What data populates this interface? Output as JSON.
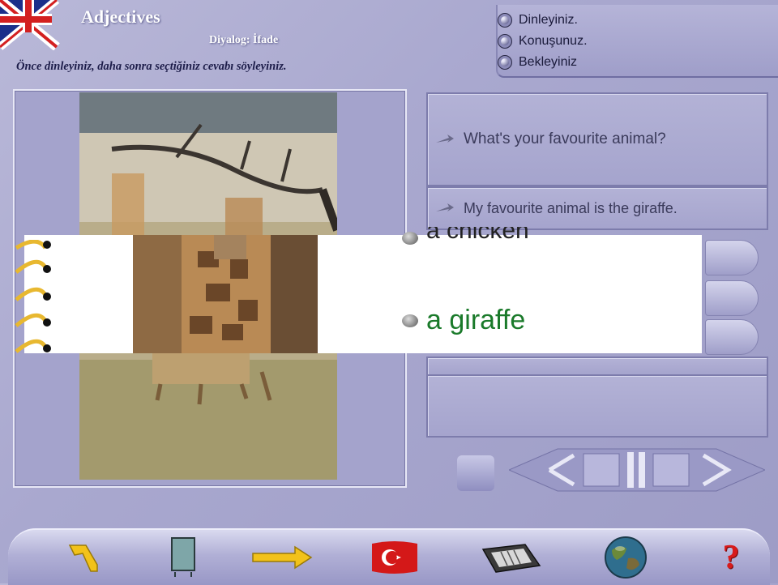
{
  "header": {
    "title": "Adjectives",
    "subtitle": "Diyalog: İfade",
    "instruction": "Önce dinleyiniz, daha sonra seçtiğiniz cevabı söyleyiniz."
  },
  "status": {
    "items": [
      {
        "label": "Dinleyiniz."
      },
      {
        "label": "Konuşunuz."
      },
      {
        "label": "Bekleyiniz"
      }
    ]
  },
  "dialog": {
    "question": "What's your favourite animal?",
    "answer": "My favourite animal is the giraffe."
  },
  "options": {
    "chicken": "a chicken",
    "giraffe": "a giraffe"
  },
  "toolbar": {
    "help_symbol": "?"
  },
  "colors": {
    "background": "#a9a8cf",
    "answer_green": "#1a7a2a",
    "help_red": "#d81b1b"
  },
  "icons": [
    "uk-flag-icon",
    "status-dot-icon",
    "speech-arrow-icon",
    "spiral-binding-icon",
    "back-arrow-icon",
    "notebook-icon",
    "forward-arrow-icon",
    "turkish-flag-icon",
    "keyboard-icon",
    "globe-icon",
    "help-icon"
  ]
}
